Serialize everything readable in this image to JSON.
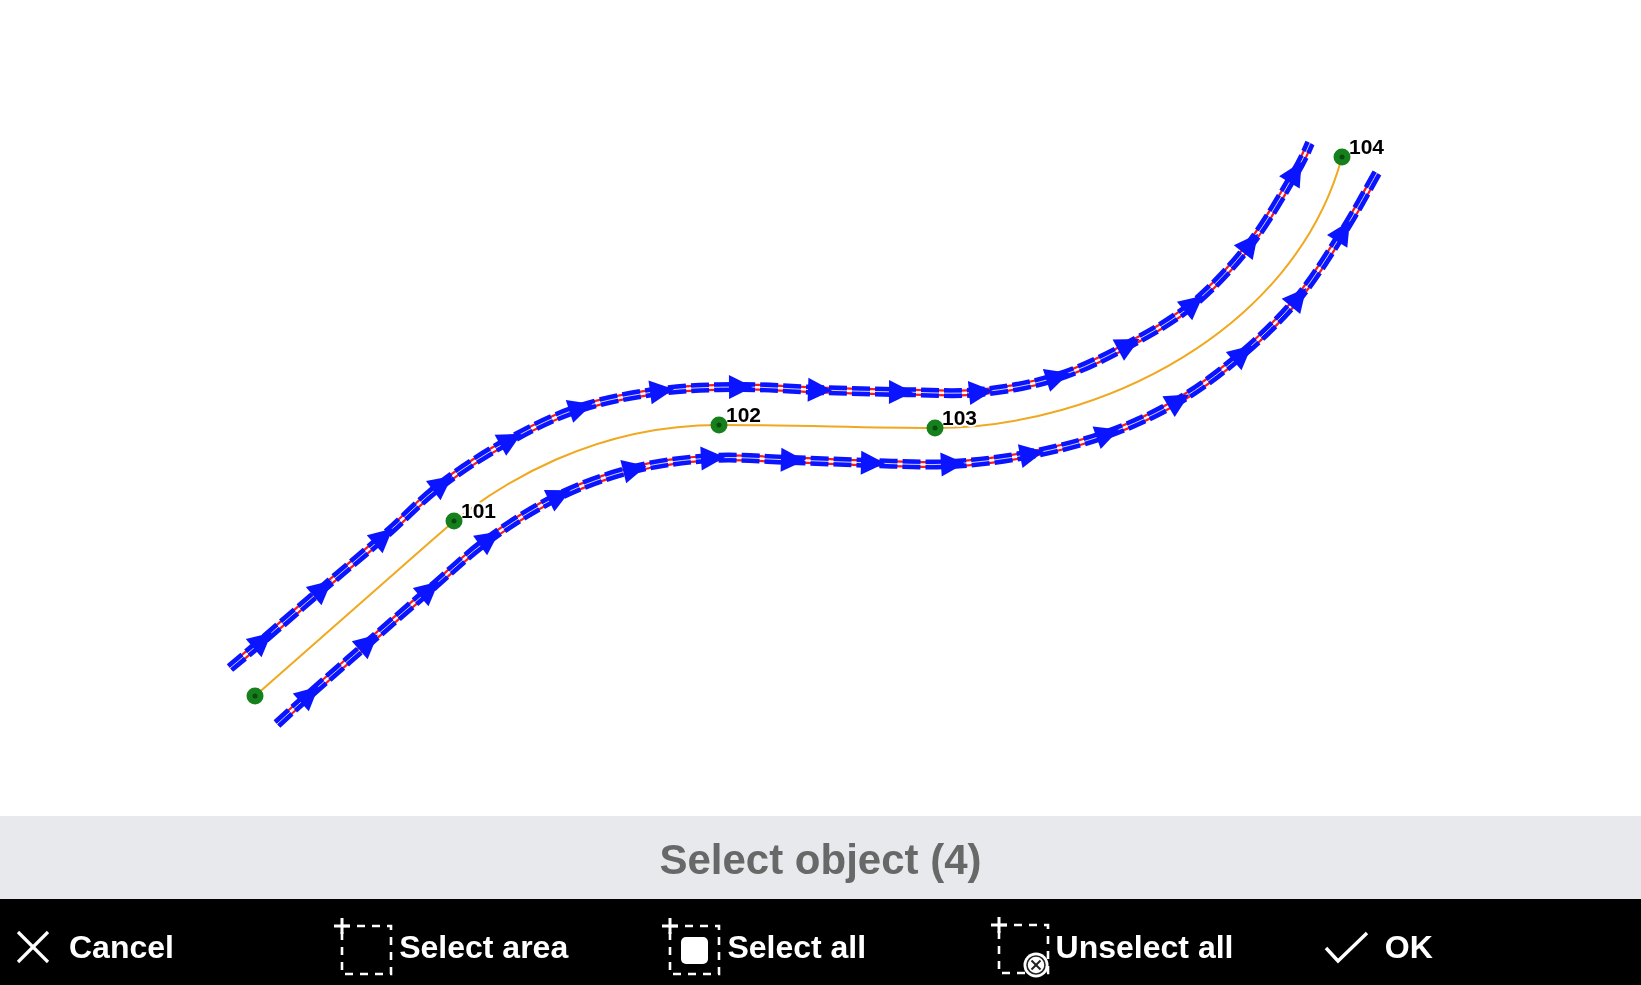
{
  "map": {
    "route": {
      "points": [
        {
          "kind": "start"
        },
        {
          "kind": "numbered",
          "label": "101"
        },
        {
          "kind": "numbered",
          "label": "102"
        },
        {
          "kind": "numbered",
          "label": "103"
        },
        {
          "kind": "numbered",
          "label": "104"
        }
      ]
    }
  },
  "status_bar": {
    "message": "Select object (4)"
  },
  "toolbar": [
    {
      "kind": "cancel",
      "label": "Cancel"
    },
    {
      "kind": "select_area",
      "label": "Select area"
    },
    {
      "kind": "select_all",
      "label": "Select all"
    },
    {
      "kind": "unselect_all",
      "label": "Unselect all"
    },
    {
      "kind": "ok",
      "label": "OK"
    }
  ]
}
